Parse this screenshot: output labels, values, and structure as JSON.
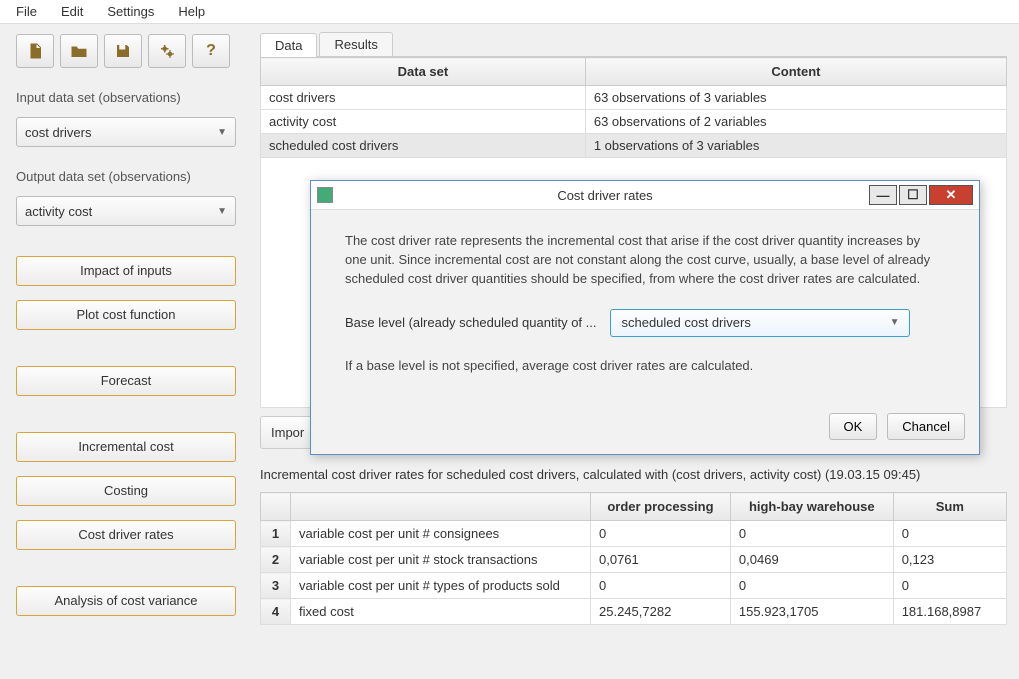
{
  "menu": {
    "file": "File",
    "edit": "Edit",
    "settings": "Settings",
    "help": "Help"
  },
  "sidebar": {
    "input_label": "Input data set (observations)",
    "input_value": "cost drivers",
    "output_label": "Output data set (observations)",
    "output_value": "activity cost",
    "buttons": [
      "Impact of inputs",
      "Plot cost function",
      "Forecast",
      "Incremental cost",
      "Costing",
      "Cost driver rates",
      "Analysis of cost variance"
    ]
  },
  "tabs": {
    "data": "Data",
    "results": "Results"
  },
  "data_table": {
    "headers": [
      "Data set",
      "Content"
    ],
    "rows": [
      {
        "set": "cost drivers",
        "content": "63 observations of 3 variables",
        "sel": false
      },
      {
        "set": "activity cost",
        "content": "63 observations of 2 variables",
        "sel": false
      },
      {
        "set": "scheduled cost drivers",
        "content": "1 observations of 3 variables",
        "sel": true
      }
    ]
  },
  "import_btn": "Impor",
  "result_title": "Incremental cost driver rates for scheduled cost drivers, calculated with (cost drivers, activity cost) (19.03.15 09:45)",
  "result_table": {
    "headers": [
      "",
      "",
      "order processing",
      "high-bay warehouse",
      "Sum"
    ],
    "rows": [
      {
        "n": "1",
        "label": "variable cost per unit # consignees",
        "c1": "0",
        "c2": "0",
        "c3": "0"
      },
      {
        "n": "2",
        "label": "variable cost per unit # stock transactions",
        "c1": "0,0761",
        "c2": "0,0469",
        "c3": "0,123"
      },
      {
        "n": "3",
        "label": "variable cost per unit # types of products sold",
        "c1": "0",
        "c2": "0",
        "c3": "0"
      },
      {
        "n": "4",
        "label": "fixed cost",
        "c1": "25.245,7282",
        "c2": "155.923,1705",
        "c3": "181.168,8987"
      }
    ]
  },
  "dialog": {
    "title": "Cost driver rates",
    "body1": "The cost driver rate represents the incremental cost that arise if the cost driver quantity increases by one unit. Since incremental cost are not constant along the cost curve, usually, a base level of already scheduled cost driver quantities should be specified, from where the cost driver rates are calculated.",
    "base_label": "Base level (already scheduled quantity of ...",
    "base_value": "scheduled cost drivers",
    "body2": "If a base level is not specified, average cost driver rates are calculated.",
    "ok": "OK",
    "cancel": "Chancel"
  }
}
